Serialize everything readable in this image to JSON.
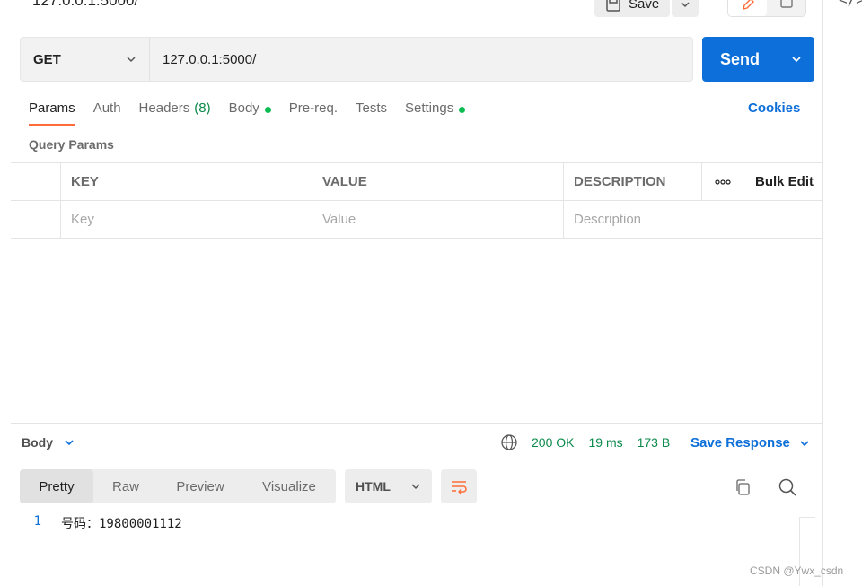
{
  "header": {
    "request_title": "127.0.0.1:5000/",
    "save_label": "Save"
  },
  "request": {
    "method": "GET",
    "url": "127.0.0.1:5000/",
    "send_label": "Send"
  },
  "tabs": [
    {
      "label": "Params",
      "active": true
    },
    {
      "label": "Auth"
    },
    {
      "label": "Headers",
      "count": "(8)"
    },
    {
      "label": "Body",
      "dot": true
    },
    {
      "label": "Pre-req."
    },
    {
      "label": "Tests"
    },
    {
      "label": "Settings",
      "dot": true
    }
  ],
  "cookies_label": "Cookies",
  "query_params": {
    "title": "Query Params",
    "columns": {
      "key": "KEY",
      "value": "VALUE",
      "description": "DESCRIPTION",
      "more": "ooo",
      "bulk_edit": "Bulk Edit"
    },
    "placeholders": {
      "key": "Key",
      "value": "Value",
      "description": "Description"
    }
  },
  "response": {
    "body_label": "Body",
    "status": "200 OK",
    "time": "19 ms",
    "size": "173 B",
    "save_response_label": "Save Response",
    "views": [
      "Pretty",
      "Raw",
      "Preview",
      "Visualize"
    ],
    "active_view": "Pretty",
    "format": "HTML",
    "lines": [
      {
        "no": "1",
        "text": "号码：19800001112"
      }
    ]
  },
  "watermark": "CSDN @Ywx_csdn",
  "colors": {
    "accent": "#0d6fd9",
    "tab_underline": "#ff6c37",
    "status_green": "#0b8a4a",
    "dot_green": "#0cbb52"
  }
}
